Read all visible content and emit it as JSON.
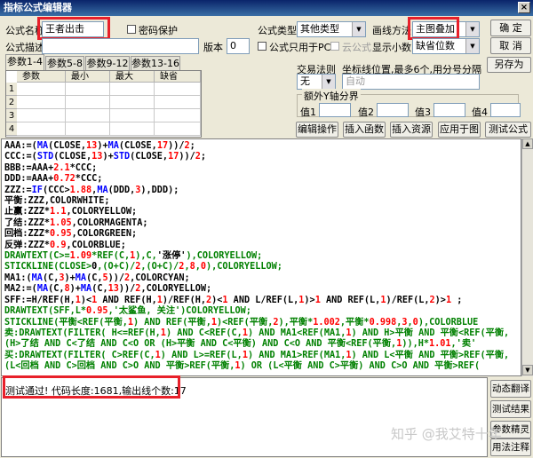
{
  "window": {
    "title": "指标公式编辑器",
    "close_glyph": "×"
  },
  "form": {
    "name_label": "公式名称",
    "name_value": "王者出击",
    "password_label": "密码保护",
    "type_label": "公式类型",
    "type_value": "其他类型",
    "draw_label": "画线方法",
    "draw_value": "主图叠加",
    "desc_label": "公式描述",
    "version_label": "版本",
    "version_value": "0",
    "pc_only_label": "公式只用于PC",
    "cloud_label": "云公式",
    "decimals_label": "显示小数",
    "decimals_value": "缺省位数",
    "rule_label": "交易法则",
    "rule_value": "无",
    "coord_label": "坐标线位置,最多6个,用分号分隔",
    "coord_value": "自动",
    "extra_axis_label": "额外Y轴分界",
    "values": [
      "值1",
      "值2",
      "值3",
      "值4"
    ]
  },
  "tabs": [
    "参数1-4",
    "参数5-8",
    "参数9-12",
    "参数13-16"
  ],
  "param_table": {
    "headers": [
      "参数",
      "最小",
      "最大",
      "缺省"
    ],
    "rows": [
      "1",
      "2",
      "3",
      "4"
    ]
  },
  "buttons": {
    "ok": "确  定",
    "cancel": "取  消",
    "save_as": "另存为",
    "edit_ops": "编辑操作",
    "insert_func": "插入函数",
    "insert_res": "插入资源",
    "apply_chart": "应用于图",
    "test": "测试公式",
    "dyn_translate": "动态翻译",
    "test_result": "测试结果",
    "param_wizard": "参数精灵",
    "usage_note": "用法注释"
  },
  "code_lines": [
    [
      [
        "AAA:=(",
        "blk"
      ],
      [
        "MA",
        "blu"
      ],
      [
        "(CLOSE,",
        "blk"
      ],
      [
        "13",
        "red"
      ],
      [
        ")+",
        "blk"
      ],
      [
        "MA",
        "blu"
      ],
      [
        "(CLOSE,",
        "blk"
      ],
      [
        "17",
        "red"
      ],
      [
        "))/",
        "blk"
      ],
      [
        "2",
        "red"
      ],
      [
        ";",
        "blk"
      ]
    ],
    [
      [
        "CCC:=(",
        "blk"
      ],
      [
        "STD",
        "blu"
      ],
      [
        "(CLOSE,",
        "blk"
      ],
      [
        "13",
        "red"
      ],
      [
        ")+",
        "blk"
      ],
      [
        "STD",
        "blu"
      ],
      [
        "(CLOSE,",
        "blk"
      ],
      [
        "17",
        "red"
      ],
      [
        "))/",
        "blk"
      ],
      [
        "2",
        "red"
      ],
      [
        ";",
        "blk"
      ]
    ],
    [
      [
        "BBB:=AAA+",
        "blk"
      ],
      [
        "2.1",
        "red"
      ],
      [
        "*CCC;",
        "blk"
      ]
    ],
    [
      [
        "DDD:=AAA+",
        "blk"
      ],
      [
        "0.72",
        "red"
      ],
      [
        "*CCC;",
        "blk"
      ]
    ],
    [
      [
        "ZZZ:=",
        "blk"
      ],
      [
        "IF",
        "blu"
      ],
      [
        "(CCC>",
        "blk"
      ],
      [
        "1.88",
        "red"
      ],
      [
        ",",
        "blk"
      ],
      [
        "MA",
        "blu"
      ],
      [
        "(DDD,",
        "blk"
      ],
      [
        "3",
        "red"
      ],
      [
        "),DDD);",
        "blk"
      ]
    ],
    [
      [
        "平衡:ZZZ,COLORWHITE;",
        "blk"
      ]
    ],
    [
      [
        "止赢:ZZZ*",
        "blk"
      ],
      [
        "1.1",
        "red"
      ],
      [
        ",COLORYELLOW;",
        "blk"
      ]
    ],
    [
      [
        "了结:ZZZ*",
        "blk"
      ],
      [
        "1.05",
        "red"
      ],
      [
        ",COLORMAGENTA;",
        "blk"
      ]
    ],
    [
      [
        "回档:ZZZ*",
        "blk"
      ],
      [
        "0.95",
        "red"
      ],
      [
        ",COLORGREEN;",
        "blk"
      ]
    ],
    [
      [
        "反弹:ZZZ*",
        "blk"
      ],
      [
        "0.9",
        "red"
      ],
      [
        ",COLORBLUE;",
        "blk"
      ]
    ],
    [
      [
        "DRAWTEXT(C>=",
        "grn"
      ],
      [
        "1.09",
        "red"
      ],
      [
        "*REF(C,",
        "grn"
      ],
      [
        "1",
        "red"
      ],
      [
        "),C,",
        "grn"
      ],
      [
        "'涨停'",
        "blk"
      ],
      [
        "),COLORYELLOW;",
        "grn"
      ]
    ],
    [
      [
        "STICKLINE(CLOSE>",
        "grn"
      ],
      [
        "0",
        ""
      ],
      [
        ",(O+C)/",
        "grn"
      ],
      [
        "2",
        "red"
      ],
      [
        ",(O+C)/",
        "grn"
      ],
      [
        "2",
        "red"
      ],
      [
        ",",
        "grn"
      ],
      [
        "8",
        "red"
      ],
      [
        ",",
        "grn"
      ],
      [
        "0",
        "red"
      ],
      [
        "),COLORYELLOW;",
        "grn"
      ]
    ],
    [
      [
        "MA1:(",
        "blk"
      ],
      [
        "MA",
        "blu"
      ],
      [
        "(C,",
        "blk"
      ],
      [
        "3",
        "red"
      ],
      [
        ")+",
        "blk"
      ],
      [
        "MA",
        "blu"
      ],
      [
        "(C,",
        "blk"
      ],
      [
        "5",
        "red"
      ],
      [
        "))/",
        "blk"
      ],
      [
        "2",
        "red"
      ],
      [
        ",COLORCYAN;",
        "blk"
      ]
    ],
    [
      [
        "MA2:=(",
        "blk"
      ],
      [
        "MA",
        "blu"
      ],
      [
        "(C,",
        "blk"
      ],
      [
        "8",
        "red"
      ],
      [
        ")+",
        "blk"
      ],
      [
        "MA",
        "blu"
      ],
      [
        "(C,",
        "blk"
      ],
      [
        "13",
        "red"
      ],
      [
        "))/",
        "blk"
      ],
      [
        "2",
        "red"
      ],
      [
        ",COLORYELLOW;",
        "blk"
      ]
    ],
    [
      [
        "SFF:=H/REF(H,",
        "blk"
      ],
      [
        "1",
        "red"
      ],
      [
        ")<",
        "blk"
      ],
      [
        "1",
        "red"
      ],
      [
        " AND REF(H,",
        "blk"
      ],
      [
        "1",
        "red"
      ],
      [
        ")/REF(H,",
        "blk"
      ],
      [
        "2",
        "red"
      ],
      [
        ")<",
        "blk"
      ],
      [
        "1",
        "red"
      ],
      [
        " AND L/REF(L,",
        "blk"
      ],
      [
        "1",
        "red"
      ],
      [
        ")>",
        "blk"
      ],
      [
        "1",
        "red"
      ],
      [
        " AND REF(L,",
        "blk"
      ],
      [
        "1",
        "red"
      ],
      [
        ")/REF(L,",
        "blk"
      ],
      [
        "2",
        "red"
      ],
      [
        ")>",
        "blk"
      ],
      [
        "1",
        "red"
      ],
      [
        " ;",
        "blk"
      ]
    ],
    [
      [
        "DRAWTEXT(SFF,L*",
        "grn"
      ],
      [
        "0.95",
        "red"
      ],
      [
        ",'太鲨鱼, 关注')COLORYELLOW;",
        "grn"
      ]
    ],
    [
      [
        "STICKLINE(平衡<REF(平衡,",
        "grn"
      ],
      [
        "1",
        "red"
      ],
      [
        ") AND REF(平衡,",
        "grn"
      ],
      [
        "1",
        "red"
      ],
      [
        ")<REF(平衡,",
        "grn"
      ],
      [
        "2",
        "red"
      ],
      [
        "),平衡*",
        "grn"
      ],
      [
        "1.002",
        "red"
      ],
      [
        ",平衡*",
        "grn"
      ],
      [
        "0.998",
        "red"
      ],
      [
        ",",
        "grn"
      ],
      [
        "3",
        "red"
      ],
      [
        ",",
        "grn"
      ],
      [
        "0",
        "red"
      ],
      [
        "),COLORBLUE",
        "grn"
      ]
    ],
    [
      [
        "卖:DRAWTEXT(FILTER( H<=REF(H,",
        "grn"
      ],
      [
        "1",
        "red"
      ],
      [
        ") AND C<REF(C,",
        "grn"
      ],
      [
        "1",
        "red"
      ],
      [
        ") AND MA1<REF(MA1,",
        "grn"
      ],
      [
        "1",
        "red"
      ],
      [
        ") AND H>平衡 AND 平衡<REF(平衡,",
        "grn"
      ]
    ],
    [
      [
        "(H>了结 AND C<了结 AND C<O OR (H>平衡 AND C<平衡) AND C<O AND 平衡<REF(平衡,",
        "grn"
      ],
      [
        "1",
        "red"
      ],
      [
        ")),H*",
        "grn"
      ],
      [
        "1.01",
        "red"
      ],
      [
        ",'卖'",
        "grn"
      ]
    ],
    [
      [
        "买:DRAWTEXT(FILTER( C>REF(C,",
        "grn"
      ],
      [
        "1",
        "red"
      ],
      [
        ") AND L>=REF(L,",
        "grn"
      ],
      [
        "1",
        "red"
      ],
      [
        ") AND MA1>REF(MA1,",
        "grn"
      ],
      [
        "1",
        "red"
      ],
      [
        ") AND L<平衡 AND 平衡>REF(平衡,",
        "grn"
      ]
    ],
    [
      [
        "(L<回档 AND C>回档 AND C>O AND 平衡>REF(平衡,",
        "grn"
      ],
      [
        "1",
        "red"
      ],
      [
        ") OR (L<平衡 AND C>平衡) AND C>O AND 平衡>REF(",
        "grn"
      ]
    ]
  ],
  "status": "测试通过! 代码长度:1681,输出线个数:17",
  "watermark": "知乎 @我艾特十年"
}
